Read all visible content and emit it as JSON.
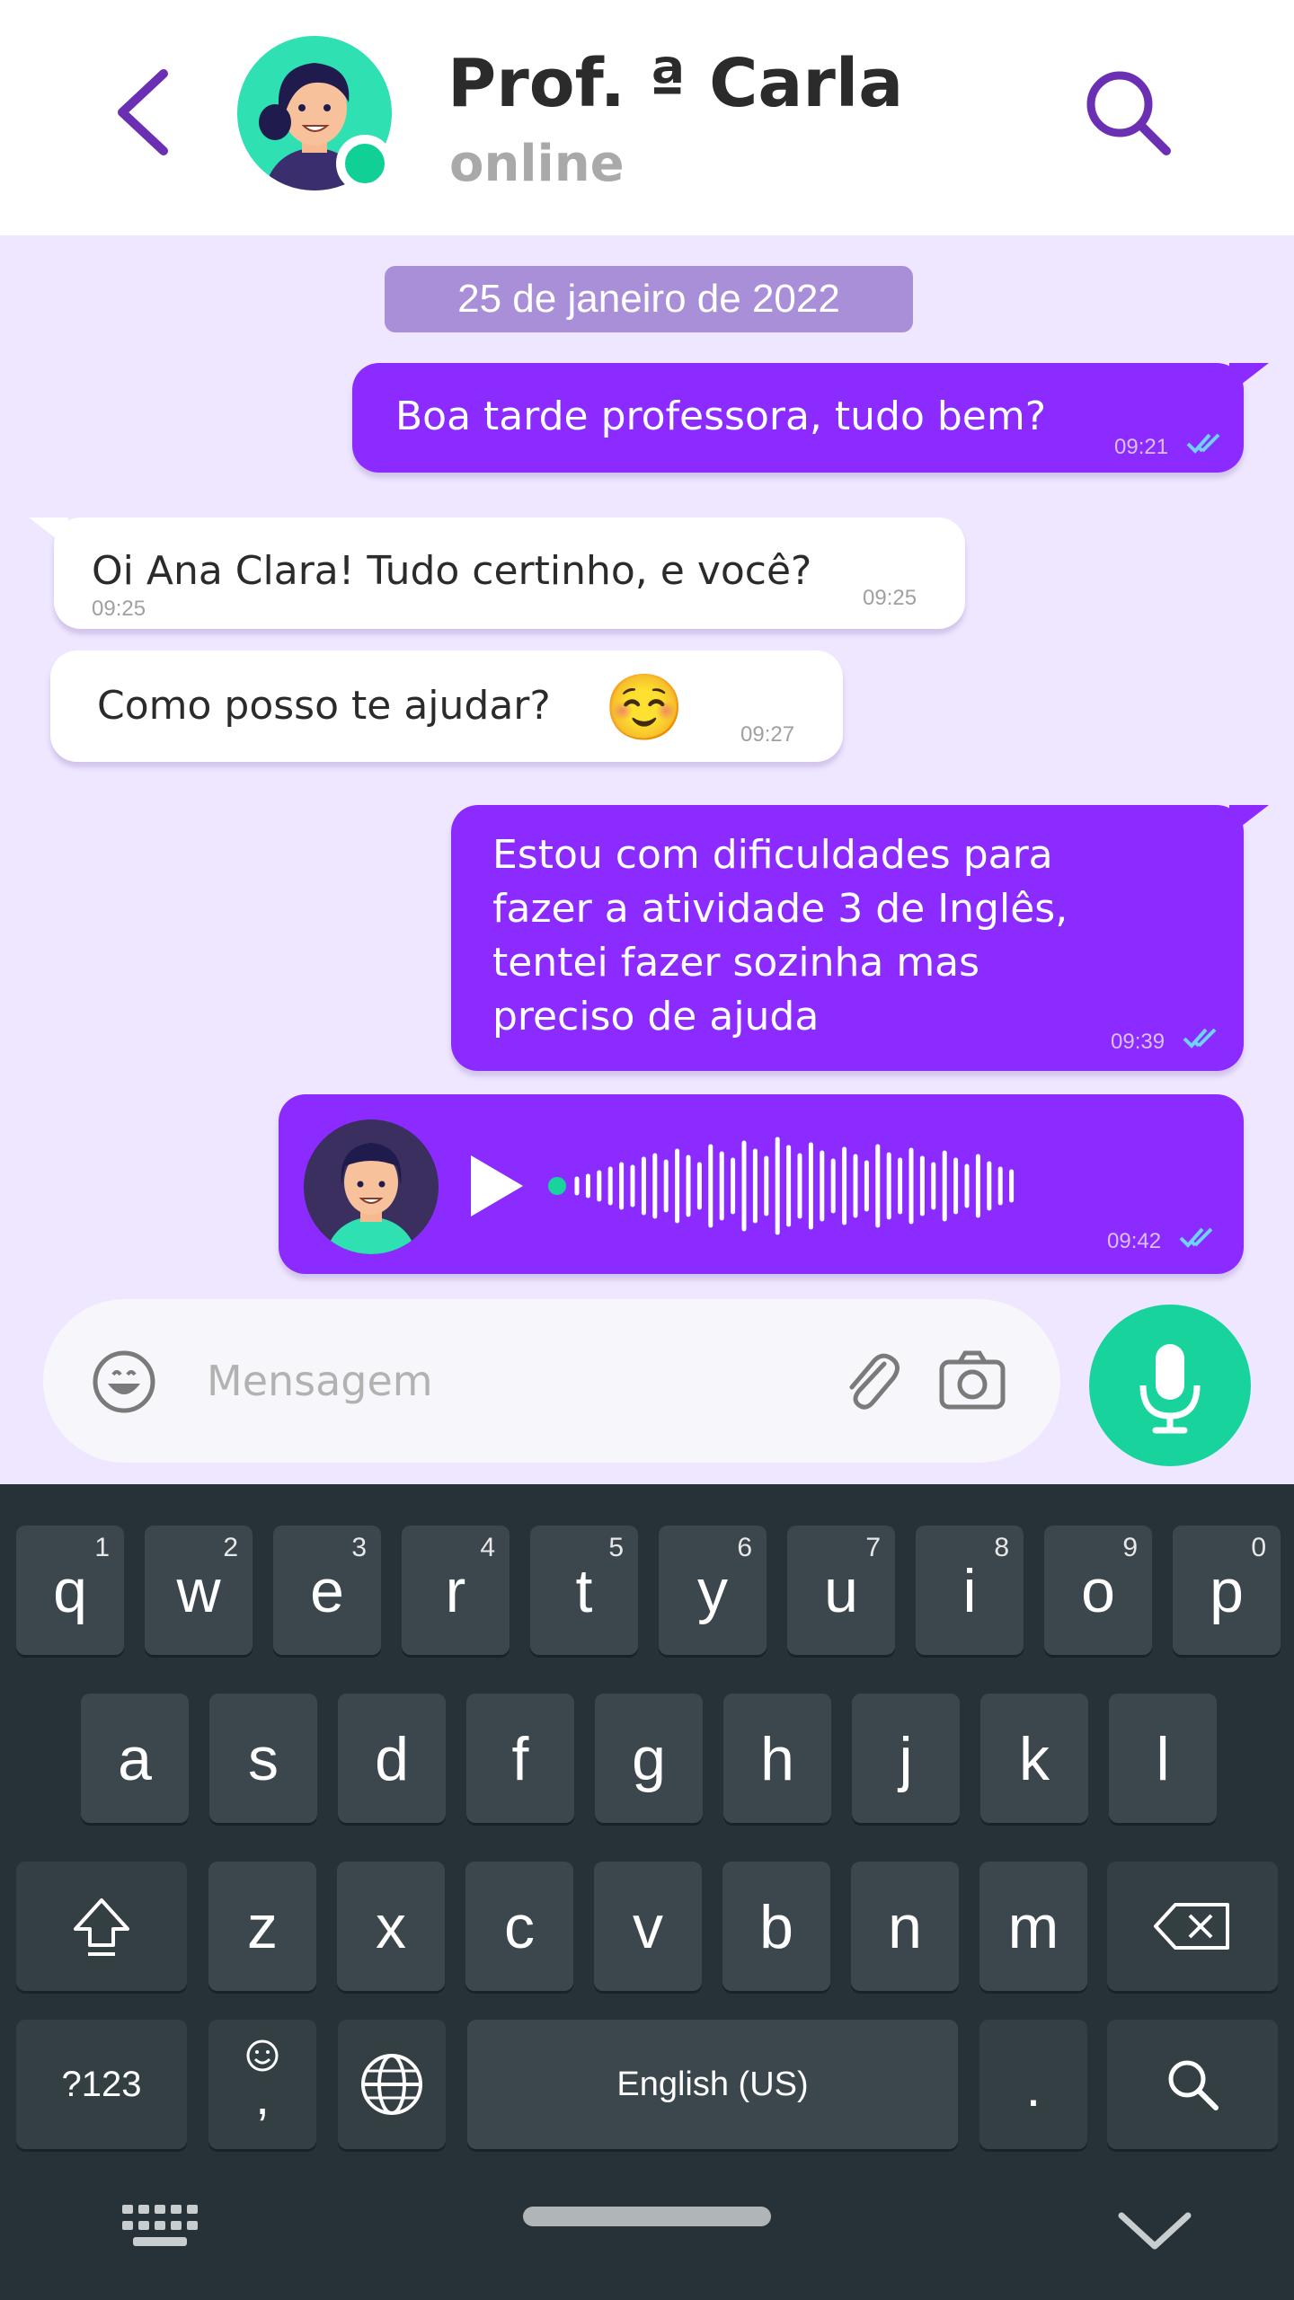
{
  "header": {
    "contact_name": "Prof. ª Carla",
    "status": "online"
  },
  "chat": {
    "date_label": "25 de janeiro de 2022",
    "messages": [
      {
        "direction": "out",
        "text": "Boa tarde professora, tudo bem?",
        "time": "09:21",
        "read": true
      },
      {
        "direction": "in",
        "text": "Oi Ana Clara! Tudo certinho, e você?",
        "time_left": "09:25",
        "time": "09:25"
      },
      {
        "direction": "in",
        "text": "Como posso te ajudar?",
        "emoji": "☺️",
        "time": "09:27"
      },
      {
        "direction": "out",
        "lines": [
          "Estou com dificuldades para",
          "fazer a atividade 3 de Inglês,",
          "tentei fazer sozinha mas",
          "preciso de ajuda"
        ],
        "time": "09:39",
        "read": true
      },
      {
        "direction": "out",
        "type": "audio",
        "time": "09:42",
        "read": true
      }
    ]
  },
  "composer": {
    "placeholder": "Mensagem"
  },
  "keyboard": {
    "row1": [
      {
        "key": "q",
        "num": "1"
      },
      {
        "key": "w",
        "num": "2"
      },
      {
        "key": "e",
        "num": "3"
      },
      {
        "key": "r",
        "num": "4"
      },
      {
        "key": "t",
        "num": "5"
      },
      {
        "key": "y",
        "num": "6"
      },
      {
        "key": "u",
        "num": "7"
      },
      {
        "key": "i",
        "num": "8"
      },
      {
        "key": "o",
        "num": "9"
      },
      {
        "key": "p",
        "num": "0"
      }
    ],
    "row2": [
      "a",
      "s",
      "d",
      "f",
      "g",
      "h",
      "j",
      "k",
      "l"
    ],
    "row3": [
      "z",
      "x",
      "c",
      "v",
      "b",
      "n",
      "m"
    ],
    "symbols_label": "?123",
    "comma_label": ",",
    "space_label": "English (US)",
    "period_label": "."
  },
  "colors": {
    "accent_purple": "#8c2bff",
    "accent_green": "#19d39c",
    "chat_background": "#efe7ff",
    "keyboard_background": "#263238"
  },
  "icons": {
    "back": "chevron-left-icon",
    "search": "search-icon",
    "emoji": "smiley-icon",
    "attach": "paperclip-icon",
    "camera": "camera-icon",
    "mic": "microphone-icon",
    "play": "play-icon"
  }
}
